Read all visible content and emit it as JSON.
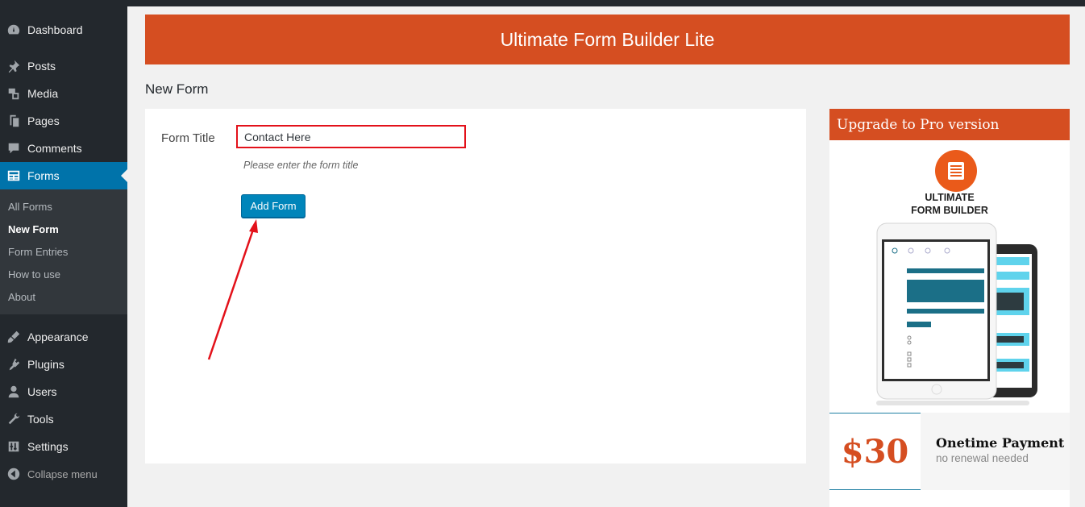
{
  "sidebar": {
    "menu": [
      {
        "label": "Dashboard",
        "icon": "dashboard-icon"
      },
      {
        "label": "Posts",
        "icon": "pin-icon"
      },
      {
        "label": "Media",
        "icon": "media-icon"
      },
      {
        "label": "Pages",
        "icon": "pages-icon"
      },
      {
        "label": "Comments",
        "icon": "comment-icon"
      },
      {
        "label": "Forms",
        "icon": "forms-icon",
        "active": true
      }
    ],
    "submenu": [
      {
        "label": "All Forms"
      },
      {
        "label": "New Form",
        "current": true
      },
      {
        "label": "Form Entries"
      },
      {
        "label": "How to use"
      },
      {
        "label": "About"
      }
    ],
    "menu_bottom": [
      {
        "label": "Appearance",
        "icon": "brush-icon"
      },
      {
        "label": "Plugins",
        "icon": "plugin-icon"
      },
      {
        "label": "Users",
        "icon": "user-icon"
      },
      {
        "label": "Tools",
        "icon": "wrench-icon"
      },
      {
        "label": "Settings",
        "icon": "settings-icon"
      }
    ],
    "collapse_label": "Collapse menu"
  },
  "banner": {
    "title": "Ultimate Form Builder Lite"
  },
  "page": {
    "heading": "New Form"
  },
  "form": {
    "title_label": "Form Title",
    "title_value": "Contact Here",
    "hint": "Please enter the form title",
    "submit_label": "Add Form"
  },
  "upgrade": {
    "heading": "Upgrade to Pro version",
    "brand_line1": "ULTIMATE",
    "brand_line2": "FORM BUILDER",
    "price": "$30",
    "payment_title": "Onetime Payment",
    "payment_sub": "no renewal needed"
  },
  "colors": {
    "accent_orange": "#d54e21",
    "wp_blue": "#0073aa",
    "highlight_red": "#e3111a"
  }
}
